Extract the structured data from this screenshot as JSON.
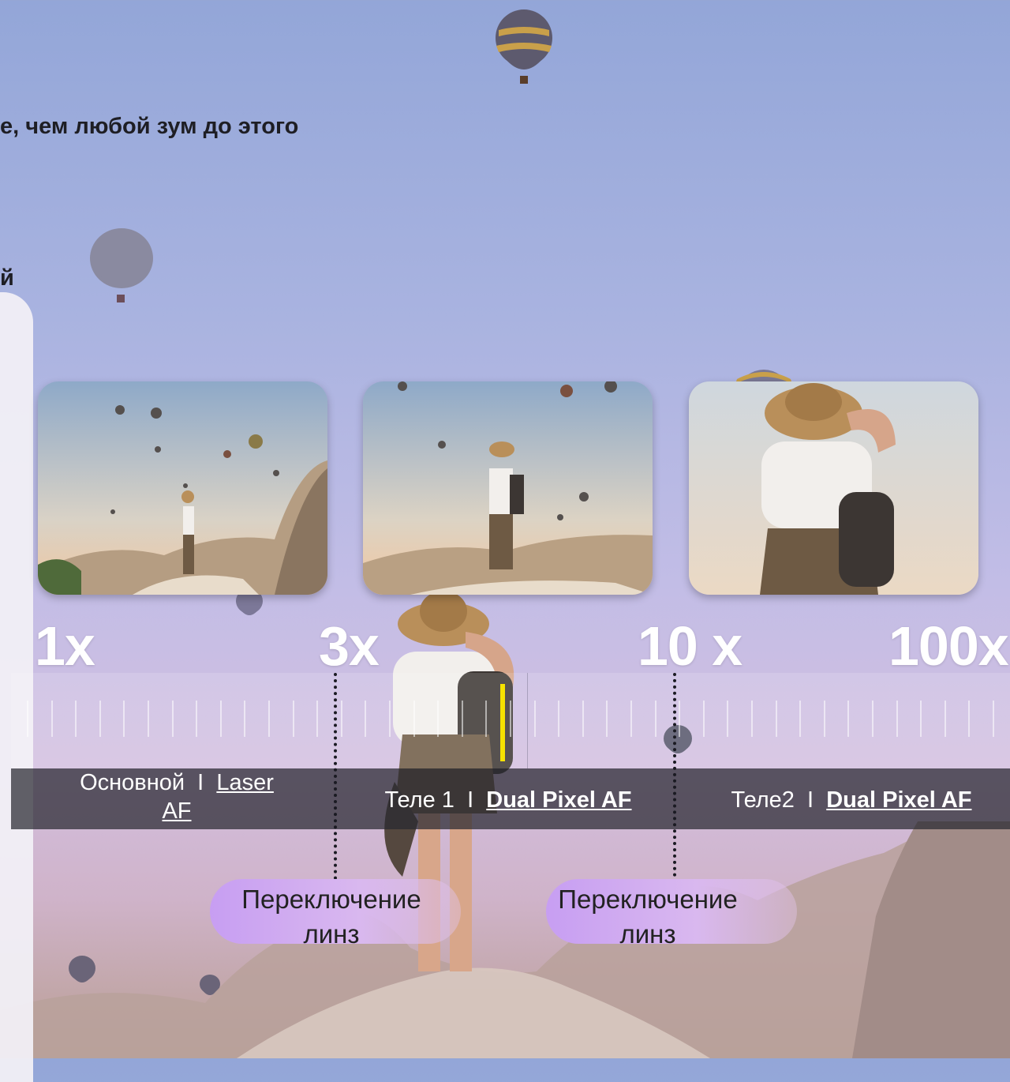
{
  "headings": {
    "line1": "е, чем любой зум до этого",
    "line2": "й"
  },
  "zoom_levels": [
    "1x",
    "3x",
    "10 x",
    "100x"
  ],
  "lenses": [
    {
      "name": "Основной",
      "separator": "I",
      "af": "Laser AF",
      "af_line1": "Laser",
      "af_line2": "AF"
    },
    {
      "name": "Теле 1",
      "separator": "I",
      "af": "Dual Pixel AF"
    },
    {
      "name": "Теле2",
      "separator": "I",
      "af": "Dual Pixel AF"
    }
  ],
  "lens_switches": [
    {
      "label": "Переключение линз"
    },
    {
      "label": "Переключение линз"
    }
  ],
  "thumbnails": [
    {
      "name": "1x sample photo"
    },
    {
      "name": "3x sample photo"
    },
    {
      "name": "10x sample photo"
    }
  ],
  "ruler": {
    "current_zoom_fraction": 0.49
  },
  "colors": {
    "indicator": "#f6e200",
    "pill": "#c79ef2",
    "lensbar": "#28282f"
  }
}
